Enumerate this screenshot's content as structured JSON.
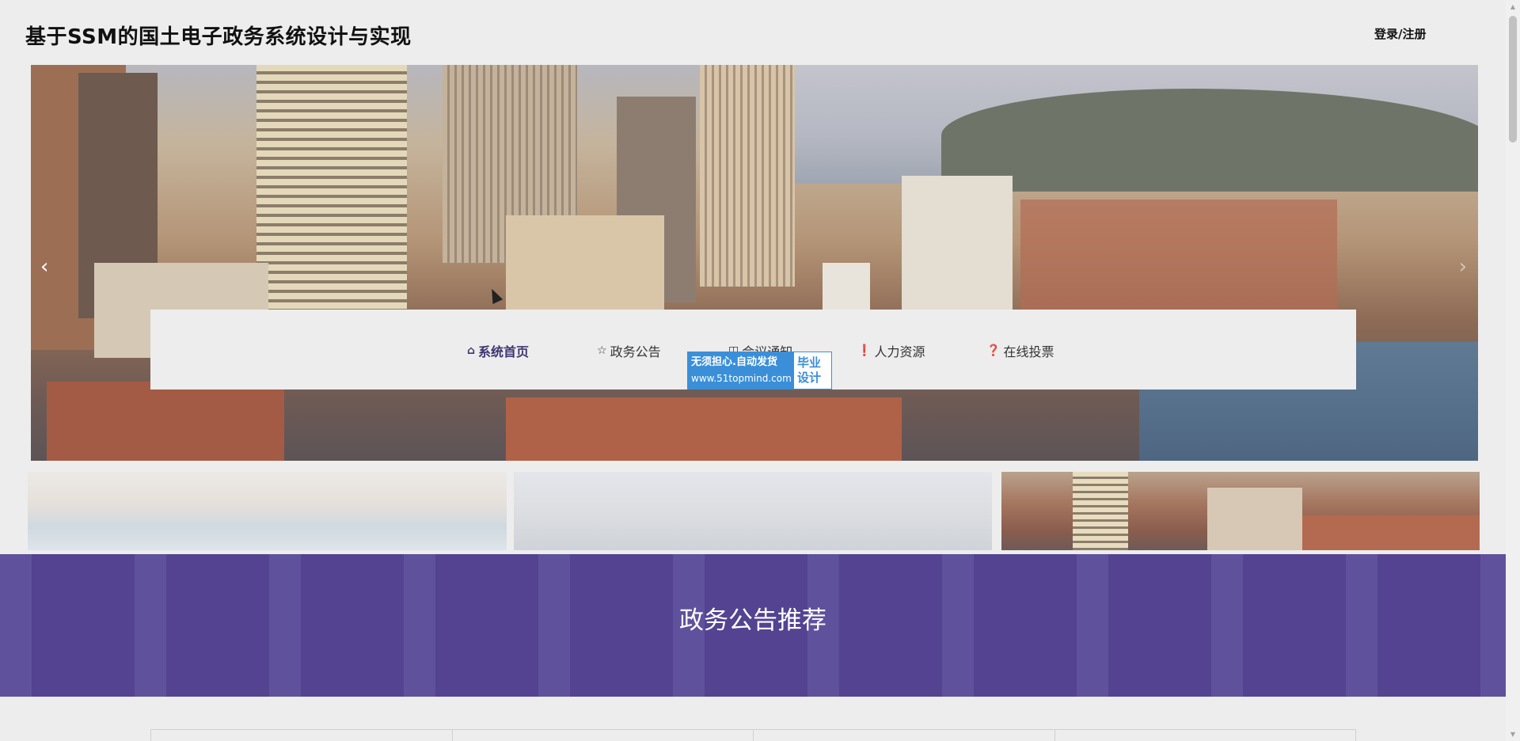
{
  "header": {
    "site_title": "基于SSM的国土电子政务系统设计与实现",
    "login_label": "登录/注册"
  },
  "banner": {
    "prev_icon": "chevron-left-icon",
    "next_icon": "chevron-right-icon",
    "prev_glyph": "‹",
    "next_glyph": "›"
  },
  "nav": {
    "items": [
      {
        "label": "系统首页",
        "icon": "home-icon",
        "glyph": "⌂",
        "active": true
      },
      {
        "label": "政务公告",
        "icon": "star-icon",
        "glyph": "☆",
        "active": false
      },
      {
        "label": "会议通知",
        "icon": "bag-icon",
        "glyph": "◫",
        "active": false
      },
      {
        "label": "人力资源",
        "icon": "exclamation-circle-icon",
        "glyph": "❗",
        "active": false
      },
      {
        "label": "在线投票",
        "icon": "question-circle-icon",
        "glyph": "❓",
        "active": false
      }
    ]
  },
  "watermark": {
    "line1": "无须担心.自动发货",
    "line2": "www.51topmind.com",
    "right": "毕业设计"
  },
  "section": {
    "title": "政务公告推荐"
  },
  "colors": {
    "accent": "#564697",
    "nav_active": "#3e3470",
    "badge_blue": "#3a8fd8"
  }
}
